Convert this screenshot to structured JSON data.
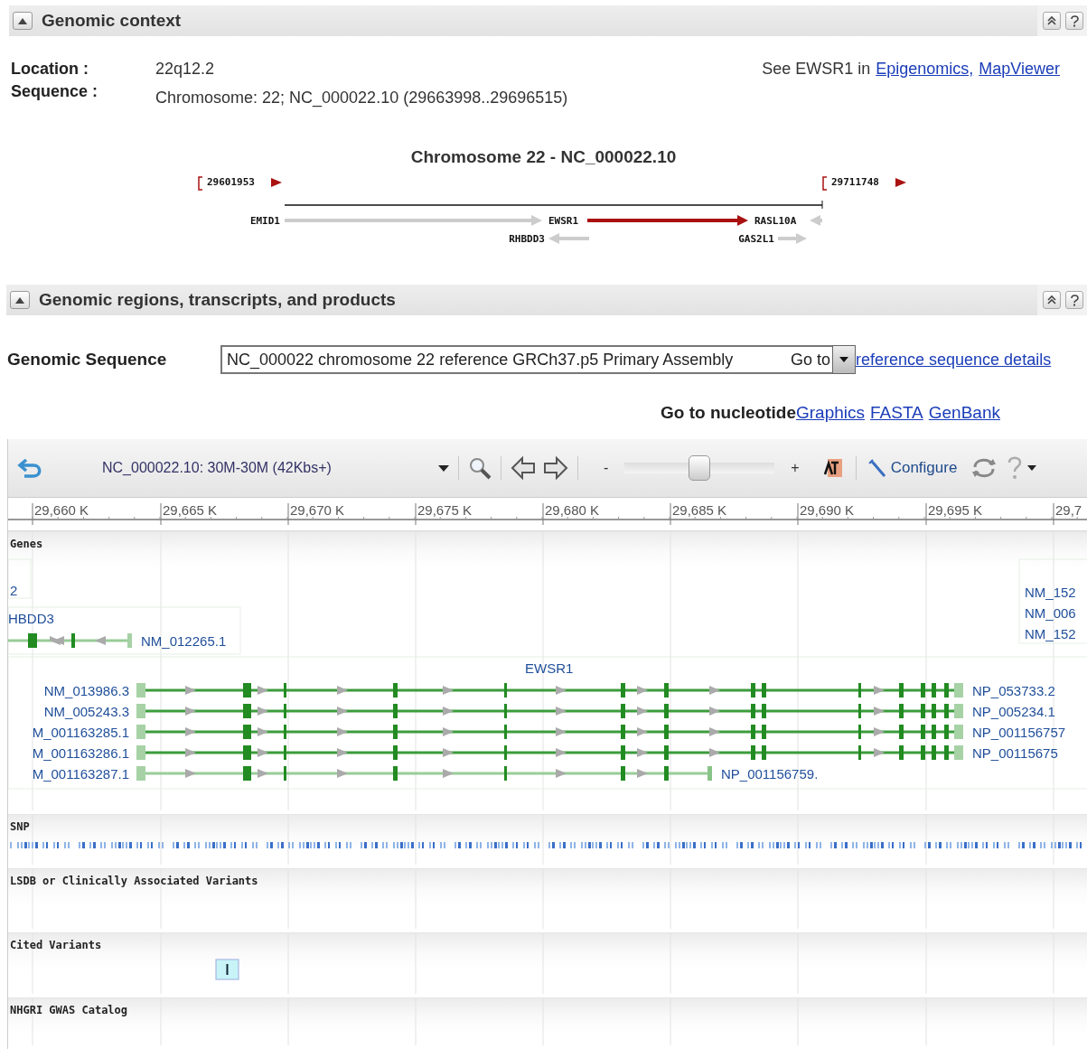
{
  "genomic_context": {
    "title": "Genomic context",
    "expanded": true,
    "location_label": "Location :",
    "location": "22q12.2",
    "sequence_label": "Sequence :",
    "sequence": "Chromosome: 22; NC_000022.10 (29663998..29696515)",
    "see_text": "See EWSR1  in",
    "links": [
      "Epigenomics,",
      "MapViewer"
    ],
    "diagram": {
      "title": "Chromosome 22 - NC_000022.10",
      "start": "29601953",
      "end": "29711748",
      "genes": [
        {
          "label": "EMID1",
          "kind": "right",
          "selected": false
        },
        {
          "label": "EWSR1",
          "kind": "right",
          "selected": true
        },
        {
          "label": "RASL10A",
          "kind": "left",
          "selected": false
        },
        {
          "label": "RHBDD3",
          "kind": "left",
          "selected": false
        },
        {
          "label": "GAS2L1",
          "kind": "right",
          "selected": false
        }
      ]
    }
  },
  "regions": {
    "title": "Genomic regions, transcripts, and products",
    "expanded": true,
    "sequence_label": "Genomic Sequence",
    "sequence_value": "NC_000022 chromosome 22 reference GRCh37.p5 Primary Assembly",
    "go_to": "Go to",
    "details_link": "reference sequence details",
    "nucleotide_label": "Go to nucleotide",
    "nucleotide_links": [
      "Graphics",
      "FASTA",
      "GenBank"
    ]
  },
  "viewer": {
    "location": "NC_000022.10: 30M-30M (42Kbs+)",
    "zoom_minus": "-",
    "zoom_plus": "+",
    "zoom": {
      "level": 0.5
    },
    "configure": "Configure",
    "ruler": [
      "29,660 K",
      "29,665 K",
      "29,670 K",
      "29,675 K",
      "29,680 K",
      "29,685 K",
      "29,690 K",
      "29,695 K",
      "29,7"
    ],
    "tracks": [
      {
        "title": "Genes",
        "kind": "genes"
      },
      {
        "title": "SNP",
        "kind": "snp"
      },
      {
        "title": "LSDB or Clinically Associated Variants",
        "kind": "empty"
      },
      {
        "title": "Cited Variants",
        "kind": "cited"
      },
      {
        "title": "NHGRI GWAS Catalog",
        "kind": "empty"
      }
    ],
    "genes": {
      "left_gene": "2",
      "rhbdd3": "HBDD3",
      "rhbdd3_transcript": "NM_012265.1",
      "right_labels": [
        "NM_152",
        "NM_006",
        "NM_152"
      ],
      "ewsr1": "EWSR1",
      "transcripts": [
        {
          "left": "NM_013986.3",
          "right": "NP_053733.2",
          "kind": "full"
        },
        {
          "left": "NM_005243.3",
          "right": "NP_005234.1",
          "kind": "full"
        },
        {
          "left": "M_001163285.1",
          "right": "NP_001156757",
          "kind": "full"
        },
        {
          "left": "M_001163286.1",
          "right": "NP_00115675",
          "kind": "full"
        },
        {
          "left": "M_001163287.1",
          "right": "NP_001156759.",
          "kind": "short"
        }
      ]
    }
  }
}
